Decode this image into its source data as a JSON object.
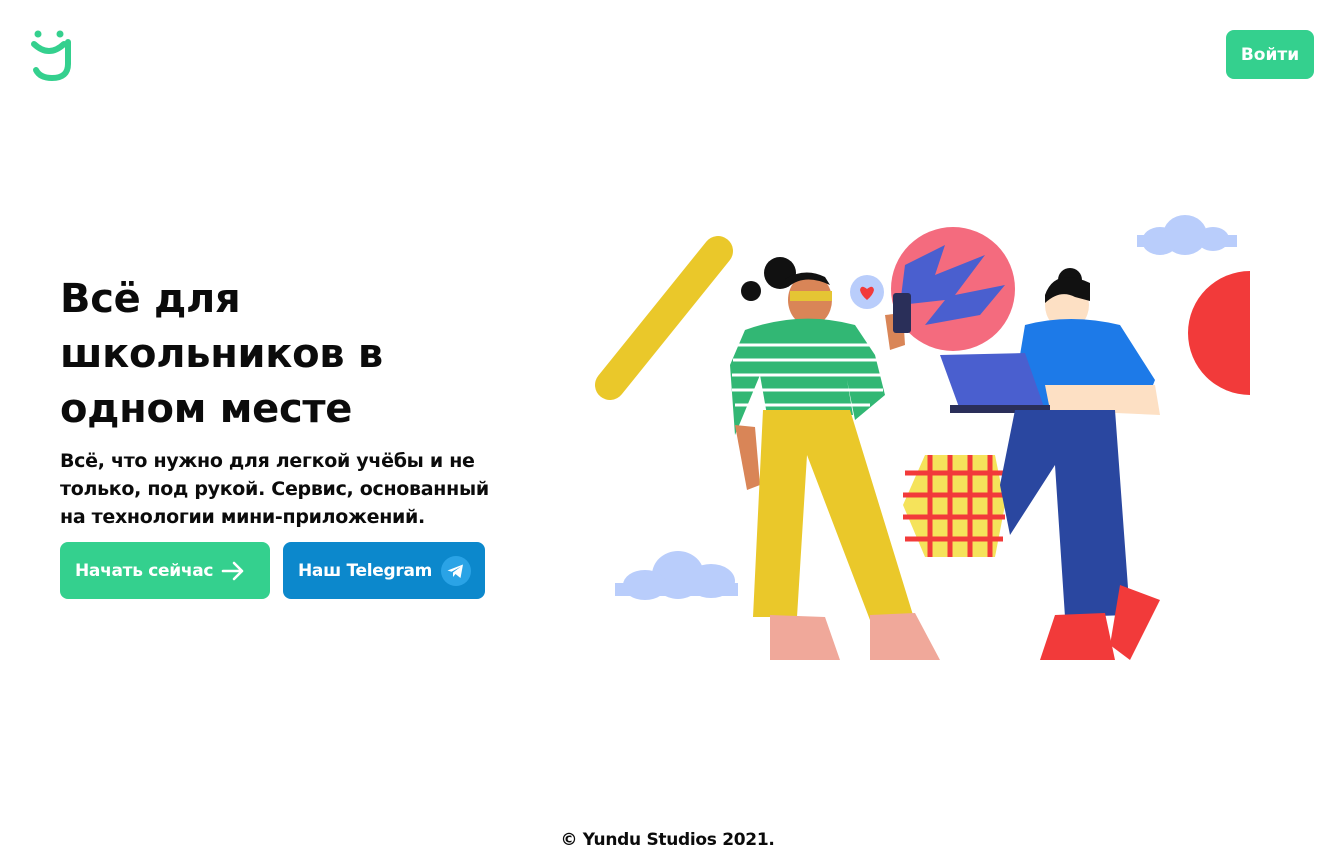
{
  "header": {
    "logo_icon": "yundu-smile-logo-icon",
    "login_label": "Войти"
  },
  "hero": {
    "title": "Всё для школьников в одном месте",
    "subtitle": "Всё, что нужно для легкой учёбы и не только, под рукой. Сервис, основанный на технологии мини-приложений.",
    "start_button_label": "Начать сейчас",
    "start_button_icon": "arrow-right-icon",
    "telegram_button_label": "Наш Telegram",
    "telegram_button_icon": "telegram-icon"
  },
  "illustration": {
    "description_icon": "students-illustration"
  },
  "footer": {
    "copyright": "© Yundu Studios 2021."
  },
  "colors": {
    "accent_green": "#34d08e",
    "telegram_blue": "#0c88cc",
    "text": "#0b0b0b"
  }
}
